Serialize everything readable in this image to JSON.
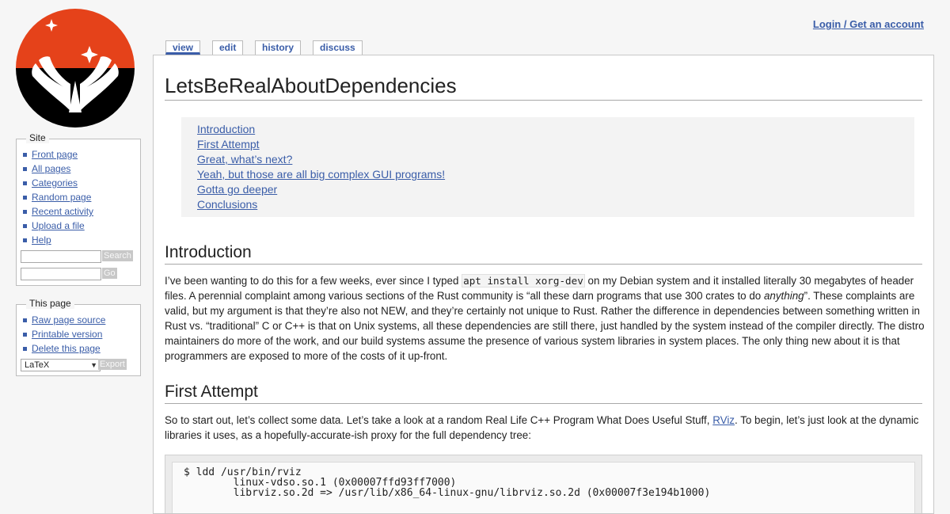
{
  "site": {
    "logo_colors": {
      "top": "#e5421a",
      "bottom": "#000000",
      "wing": "#ffffff"
    },
    "user_link": "Login / Get an account"
  },
  "sidebar": {
    "site": {
      "title": "Site",
      "items": [
        {
          "label": "Front page"
        },
        {
          "label": "All pages"
        },
        {
          "label": "Categories"
        },
        {
          "label": "Random page"
        },
        {
          "label": "Recent activity"
        },
        {
          "label": "Upload a file"
        },
        {
          "label": "Help"
        }
      ],
      "search_button": "Search",
      "go_button": "Go"
    },
    "page": {
      "title": "This page",
      "items": [
        {
          "label": "Raw page source"
        },
        {
          "label": "Printable version"
        },
        {
          "label": "Delete this page"
        }
      ],
      "export_format": "LaTeX",
      "export_button": "Export"
    }
  },
  "tabs": [
    {
      "label": "view",
      "active": true
    },
    {
      "label": "edit"
    },
    {
      "label": "history"
    },
    {
      "label": "discuss"
    }
  ],
  "page": {
    "title": "LetsBeRealAboutDependencies",
    "toc": [
      "Introduction",
      "First Attempt",
      "Great, what’s next?",
      "Yeah, but those are all big complex GUI programs!",
      "Gotta go deeper",
      "Conclusions"
    ],
    "intro": {
      "heading": "Introduction",
      "p1": "I’ve been wanting to do this for a few weeks, ever since I typed ",
      "code": "apt install xorg-dev",
      "p2": " on my Debian system and it installed literally 30 megabytes of header files. A perennial complaint among various sections of the Rust community is “all these darn programs that use 300 crates to do ",
      "em": "anything",
      "p3": "”. These complaints are valid, but my argument is that they’re also not NEW, and they’re certainly not unique to Rust. Rather the difference in dependencies between something written in Rust vs. “traditional” C or C++ is that on Unix systems, all these dependencies are still there, just handled by the system instead of the compiler directly. The distro maintainers do more of the work, and our build systems assume the presence of various system libraries in system places. The only thing new about it is that programmers are exposed to more of the costs of it up-front."
    },
    "first_attempt": {
      "heading": "First Attempt",
      "p1": "So to start out, let’s collect some data. Let’s take a look at a random Real Life C++ Program What Does Useful Stuff, ",
      "link": "RViz",
      "p2": ". To begin, let’s just look at the dynamic libraries it uses, as a hopefully-accurate-ish proxy for the full dependency tree:",
      "code_lines": [
        "$ ldd /usr/bin/rviz",
        "        linux-vdso.so.1 (0x00007ffd93ff7000)",
        "        librviz.so.2d => /usr/lib/x86_64-linux-gnu/librviz.so.2d (0x00007f3e194b1000)"
      ]
    }
  }
}
